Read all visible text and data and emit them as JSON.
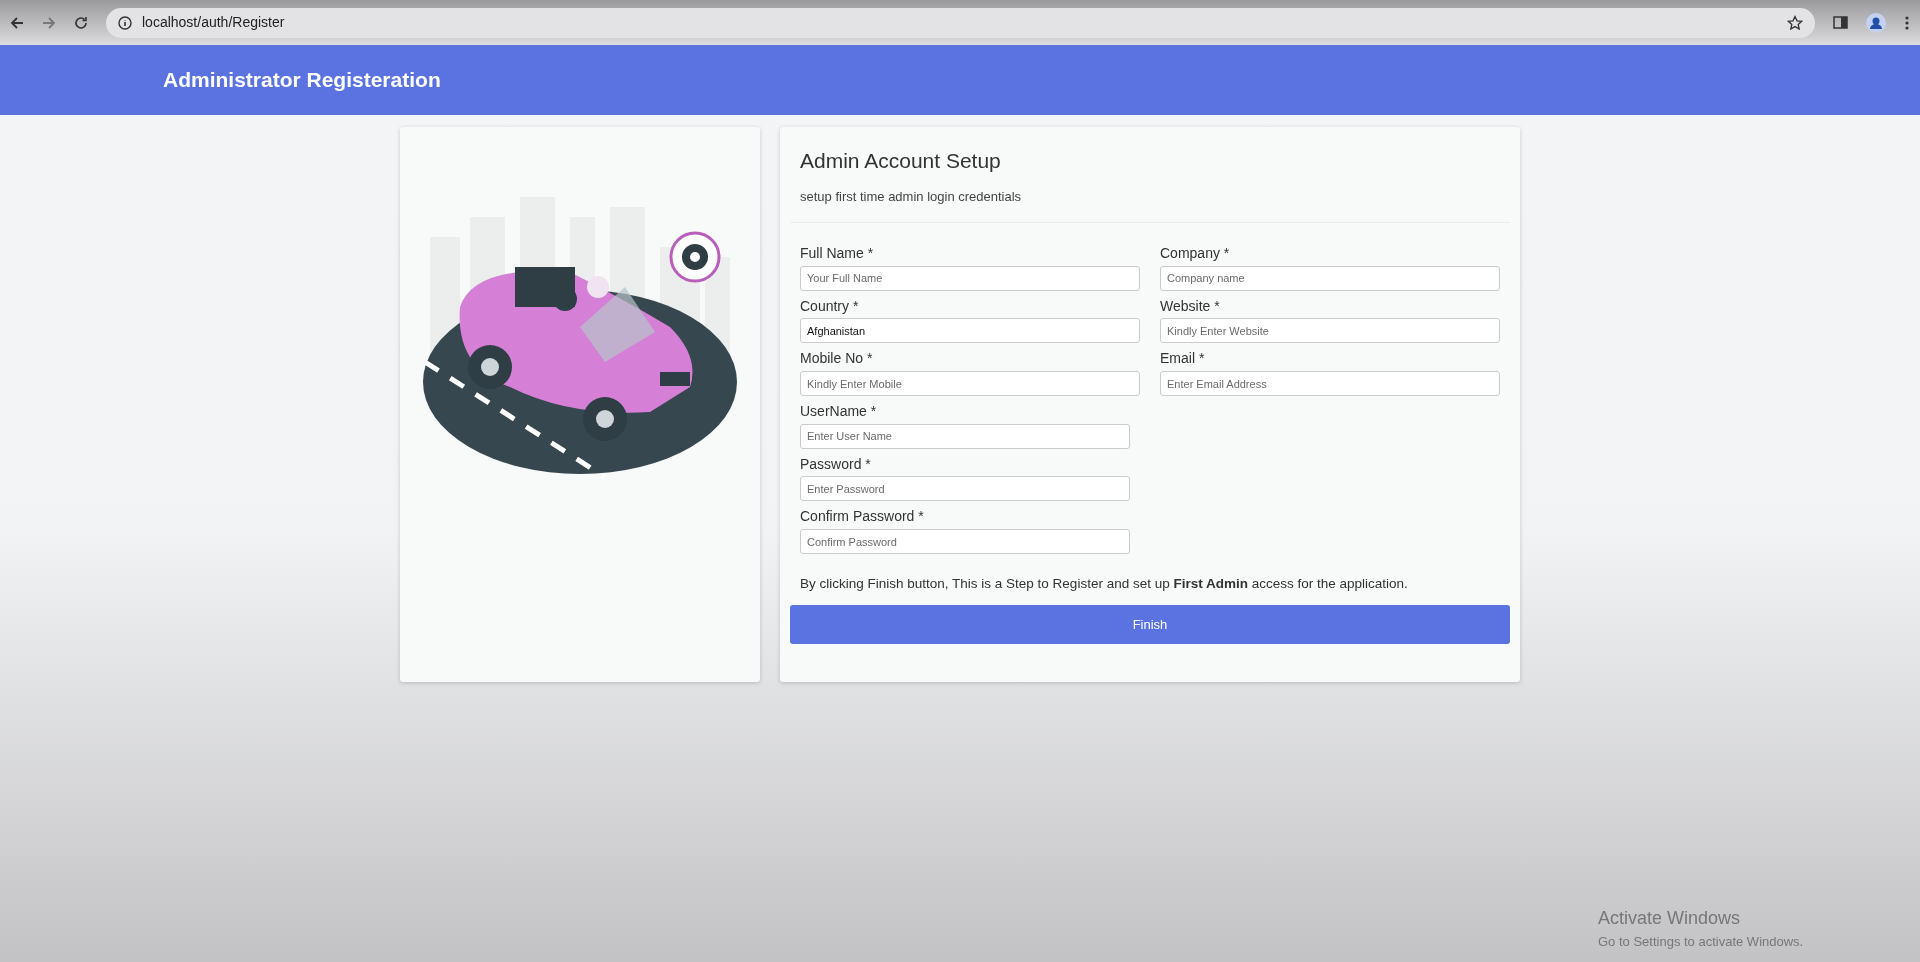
{
  "browser": {
    "url": "localhost/auth/Register"
  },
  "header": {
    "title": "Administrator Registeration"
  },
  "form": {
    "title": "Admin Account Setup",
    "subtitle": "setup first time admin login credentials",
    "rows": [
      [
        {
          "label": "Full Name *",
          "placeholder": "Your Full Name"
        },
        {
          "label": "Company *",
          "placeholder": "Company name"
        }
      ],
      [
        {
          "label": "Country *",
          "value": "Afghanistan"
        },
        {
          "label": "Website *",
          "placeholder": "Kindly Enter Website"
        }
      ],
      [
        {
          "label": "Mobile No *",
          "placeholder": "Kindly Enter Mobile"
        },
        {
          "label": "Email *",
          "placeholder": "Enter Email Address"
        }
      ],
      [
        {
          "label": "UserName *",
          "placeholder": "Enter User Name"
        }
      ],
      [
        {
          "label": "Password *",
          "placeholder": "Enter Password"
        }
      ],
      [
        {
          "label": "Confirm Password *",
          "placeholder": "Confirm Password"
        }
      ]
    ],
    "note": "By clicking Finish button, This is a Step to Register and set up **First Admin** access for the application.",
    "button": "Finish"
  },
  "os_notice": {
    "title": "Activate Windows",
    "text": "Go to Settings to activate Windows."
  }
}
